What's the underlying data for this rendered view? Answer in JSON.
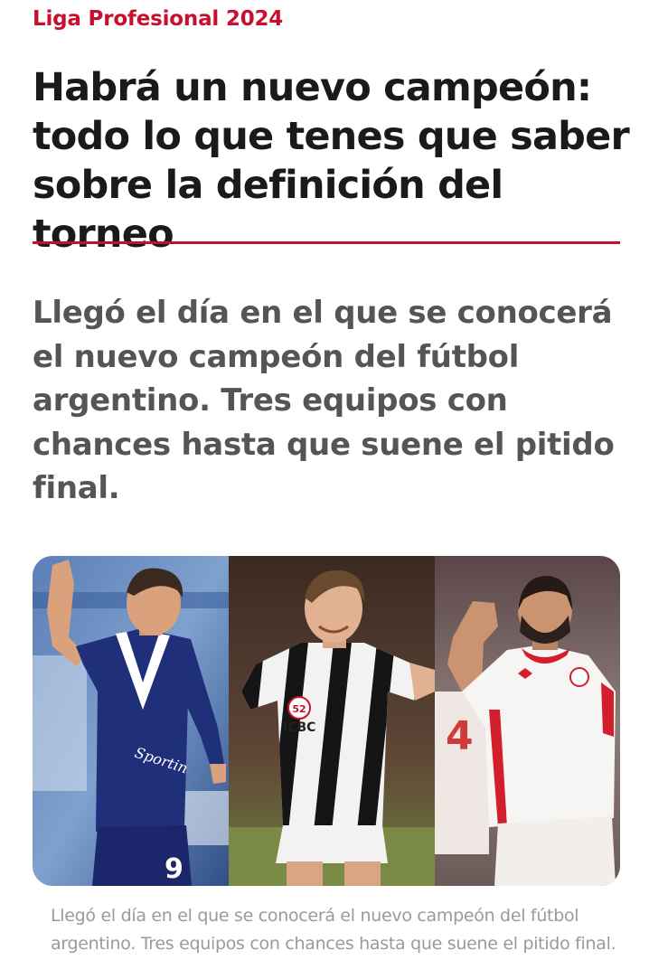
{
  "article": {
    "kicker": "Liga Profesional 2024",
    "headline": "Habrá un nuevo campeón: todo lo que tenes que saber sobre la definición del torneo",
    "lead": "Llegó el día en el que se conocerá el nuevo campeón del fútbol argentino. Tres equipos con chances hasta que suene el pitido final.",
    "image_caption": "Llegó el día en el que se conocerá el nuevo campeón del fútbol argentino. Tres equipos con chances hasta que suene el pitido final."
  },
  "colors": {
    "accent": "#c8102e",
    "headline": "#1a1a1a",
    "lead": "#555555",
    "caption": "#9a9a9a"
  },
  "photo": {
    "panels": [
      {
        "jersey_number": "9",
        "sponsor_text": "Sportin"
      },
      {
        "sponsor_text": "ICBC",
        "badge_number": "52"
      },
      {
        "jersey_number": "4"
      }
    ]
  }
}
